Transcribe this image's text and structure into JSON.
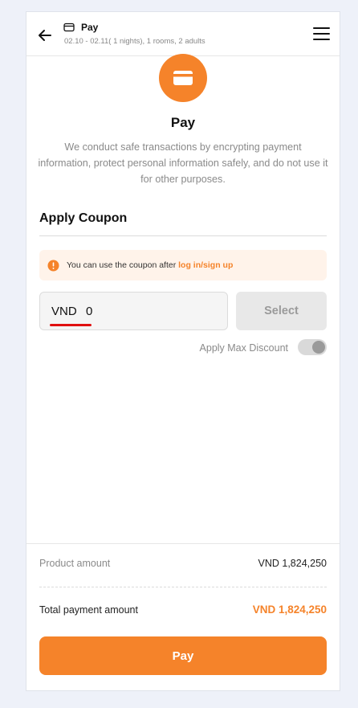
{
  "header": {
    "title": "Pay",
    "subtitle": "02.10 - 02.11( 1 nights), 1 rooms, 2 adults"
  },
  "hero": {
    "title": "Pay",
    "description": "We conduct safe transactions by encrypting payment information, protect personal information safely, and do not use it for other purposes."
  },
  "coupon": {
    "heading": "Apply Coupon",
    "notice_text": "You can use the coupon after ",
    "notice_link": "log in/sign up",
    "currency": "VND",
    "value": "0",
    "select_label": "Select",
    "max_discount_label": "Apply Max Discount",
    "max_discount_enabled": false
  },
  "summary": {
    "product_label": "Product amount",
    "product_value": "VND 1,824,250",
    "total_label": "Total payment amount",
    "total_value": "VND 1,824,250"
  },
  "pay_button": "Pay",
  "colors": {
    "accent": "#f5832a",
    "notice_bg": "#fff3ea",
    "annotation": "#e01010"
  }
}
